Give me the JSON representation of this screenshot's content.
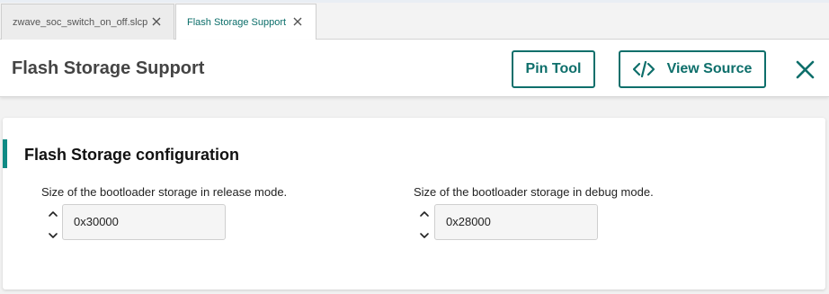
{
  "tabs": [
    {
      "label": "zwave_soc_switch_on_off.slcp",
      "active": false
    },
    {
      "label": "Flash Storage Support",
      "active": true
    }
  ],
  "header": {
    "title": "Flash Storage Support",
    "pin_tool_label": "Pin Tool",
    "view_source_label": "View Source"
  },
  "section": {
    "title": "Flash Storage configuration",
    "fields": [
      {
        "label": "Size of the bootloader storage in release mode.",
        "value": "0x30000"
      },
      {
        "label": "Size of the bootloader storage in debug mode.",
        "value": "0x28000"
      }
    ]
  },
  "colors": {
    "accent": "#0e6f6b",
    "accent_bar": "#0e8a84",
    "active_tab_text": "#0b6e6a"
  },
  "icons": [
    "close-icon",
    "code-icon",
    "chevron-up-icon",
    "chevron-down-icon"
  ]
}
